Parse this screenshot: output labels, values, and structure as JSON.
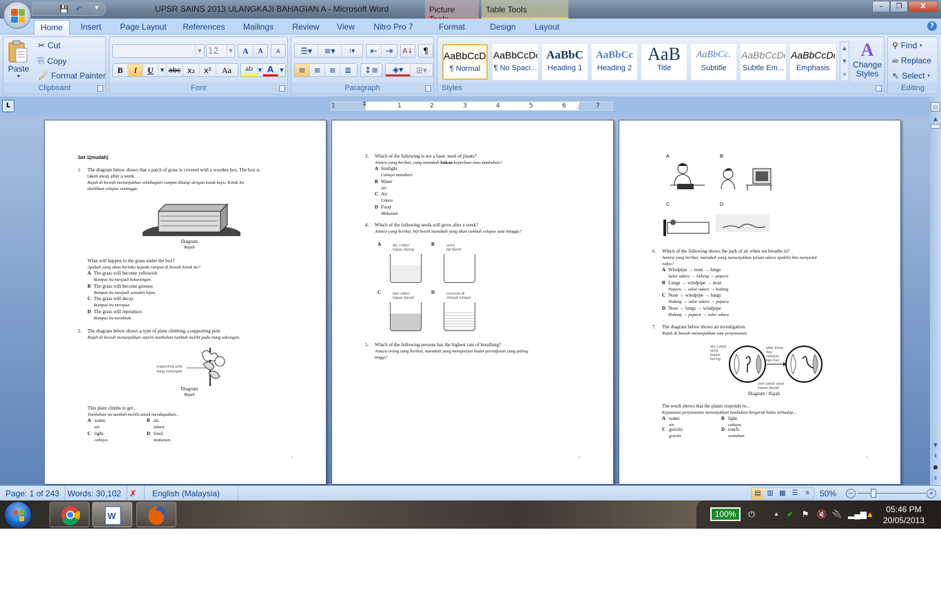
{
  "window": {
    "title": "UPSR SAINS 2013 ULANGKAJI BAHAGIAN A  -  Microsoft Word",
    "context_tabs": [
      "Picture Tools",
      "Table Tools"
    ],
    "controls": {
      "minimize": "–",
      "restore": "❐",
      "close": "X"
    }
  },
  "quick_access": {
    "save_icon": "💾",
    "undo_icon": "↶",
    "redo_icon": "↻",
    "more_icon": "▾"
  },
  "tabs": [
    {
      "label": "Home"
    },
    {
      "label": "Insert"
    },
    {
      "label": "Page Layout"
    },
    {
      "label": "References"
    },
    {
      "label": "Mailings"
    },
    {
      "label": "Review"
    },
    {
      "label": "View"
    },
    {
      "label": "Nitro Pro 7"
    },
    {
      "label": "Format"
    },
    {
      "label": "Design"
    },
    {
      "label": "Layout"
    }
  ],
  "ribbon": {
    "clipboard": {
      "label": "Clipboard",
      "paste": "Paste",
      "cut": "Cut",
      "copy": "Copy",
      "format_painter": "Format Painter"
    },
    "font": {
      "label": "Font",
      "font_name": "",
      "font_size": "12",
      "buttons": {
        "grow": "A",
        "shrink": "A",
        "clear": "A",
        "bold": "B",
        "italic": "I",
        "underline": "U",
        "strike": "abc",
        "subscript": "x₂",
        "superscript": "x²",
        "case": "Aa",
        "highlight": "ab",
        "color": "A"
      }
    },
    "paragraph": {
      "label": "Paragraph",
      "pilcrow": "¶",
      "sort": "A↓"
    },
    "styles": {
      "label": "Styles",
      "items": [
        {
          "sample": "AaBbCcDc",
          "name": "¶ Normal"
        },
        {
          "sample": "AaBbCcDc",
          "name": "¶ No Spaci..."
        },
        {
          "sample": "AaBbC",
          "name": "Heading 1"
        },
        {
          "sample": "AaBbCc",
          "name": "Heading 2"
        },
        {
          "sample": "AaB",
          "name": "Title"
        },
        {
          "sample": "AaBbCc.",
          "name": "Subtitle"
        },
        {
          "sample": "AaBbCcDc",
          "name": "Subtle Em..."
        },
        {
          "sample": "AaBbCcDc",
          "name": "Emphasis"
        }
      ],
      "change_styles": "Change Styles"
    },
    "editing": {
      "label": "Editing",
      "find": "Find",
      "replace": "Replace",
      "select": "Select"
    }
  },
  "ruler": {
    "numbers": [
      "1",
      "1",
      "2",
      "3",
      "4",
      "5",
      "6",
      "7"
    ],
    "corner": "L"
  },
  "pages": [
    {
      "number": "1",
      "heading": "Set 1(mudah)",
      "q1": {
        "num": "1.",
        "text1": "The diagram below shows that a patch of grass is covered with a wooden box. The box is",
        "text2": "taken away after a week.",
        "malay1": "Rajah di bawah menunjukkan sebahagian rumput ditutup dengan kotak kayu. Kotak itu",
        "malay2": "dialihkan selepas seminggu.",
        "caption": "Diagram",
        "caption_malay": "Rajah",
        "question": "What will happen to the grass under the box?",
        "question_malay": "Apakah yang akan berlaku kepada rumput di bawah kotak itu?",
        "options": [
          {
            "letter": "A",
            "text": "The grass will become yellowish.",
            "malay": "Rumput itu menjadi kekuningan."
          },
          {
            "letter": "B",
            "text": "The grass will become greener.",
            "malay": "Rumput itu menjadi semakin hijau."
          },
          {
            "letter": "C",
            "text": "The grass will decay.",
            "malay": "Rumput itu mereput."
          },
          {
            "letter": "D",
            "text": "The grass will reproduce.",
            "malay": "Rumput itu membiak."
          }
        ]
      },
      "q2": {
        "num": "2.",
        "text": "The diagram below shows a type of plant climbing a supporting pole.",
        "malay": "Rajah di bawah menunjukkan sejenis tumbuhan tumbuh melilit pada tiang sokongan.",
        "label1": "supporting pole",
        "label2": "tiang sokongan",
        "caption": "Diagram",
        "caption_malay": "Rajah",
        "question": "This plant climbs to get...",
        "question_malay": "Tumbuhan itu tumbuh melilit untuk mendapatkan...",
        "options": [
          {
            "letter": "A",
            "text": "water.",
            "malay": "air."
          },
          {
            "letter": "B",
            "text": "air.",
            "malay": "udara."
          },
          {
            "letter": "C",
            "text": "light.",
            "malay": "cahaya."
          },
          {
            "letter": "D",
            "text": "food.",
            "malay": "makanan."
          }
        ]
      }
    },
    {
      "number": "2",
      "q3": {
        "num": "3.",
        "text": "Which of the following is not a basic need of plants?",
        "malay_a": "Antara yang berikut, yang manakah",
        "malay_bold": "bukan",
        "malay_b": "keperluan asas tumbuhan?",
        "options": [
          {
            "letter": "A",
            "text": "Sunlight",
            "malay": "Cahaya matahari"
          },
          {
            "letter": "B",
            "text": "Water",
            "malay": "Air"
          },
          {
            "letter": "C",
            "text": "Air",
            "malay": "Udara"
          },
          {
            "letter": "D",
            "text": "Food",
            "malay": "Makanan"
          }
        ]
      },
      "q4": {
        "num": "4.",
        "text": "Which of the following seeds will grow after a week?",
        "malay": "Antara yang berikut, biji benih manakah yang akan tumbuh selepas satu minggu?",
        "beakers": [
          {
            "letter": "A",
            "label": "dry cotton",
            "label_malay": "kapas kering"
          },
          {
            "letter": "B",
            "label": "seed",
            "label_malay": "biji benih"
          },
          {
            "letter": "C",
            "label": "wet cotton",
            "label_malay": "kapas basah"
          },
          {
            "letter": "D",
            "label": "coconut oil",
            "label_malay": "minyak kelapa"
          }
        ]
      },
      "q5": {
        "num": "5.",
        "text": "Which of the following persons has the highest rate of breathing?",
        "malay1": "Antara orang yang berikut, manakah yang mempunyai kadar pernafasan yang paling",
        "malay2": "tinggi?"
      }
    },
    {
      "number": "3",
      "persons": [
        "A",
        "B",
        "C",
        "D"
      ],
      "q6": {
        "num": "6.",
        "text": "Which of the following shows the path of air when we breathe in?",
        "malay1": "Antara yang berikut, manakah yang menunjukkan laluan udara apabila kita menyedut",
        "malay2": "nafas?",
        "options": [
          {
            "letter": "A",
            "text": "Windpipe → nose → lungs",
            "malay": "Salur udara → hidung → peparu"
          },
          {
            "letter": "B",
            "text": "Lungs → windpipe → nose",
            "malay": "Peparu → salur udara → hidung"
          },
          {
            "letter": "C",
            "text": "Nose → windpipe → lungs",
            "malay": "Hidung → salur udara → peparu"
          },
          {
            "letter": "D",
            "text": "Nose → lungs → windpipe",
            "malay": "Hidung → peparu → salur udara"
          }
        ]
      },
      "q7": {
        "num": "7.",
        "text": "The diagram below shows an investigation.",
        "malay": "Rajah di bawah menunjukkan satu penyiasatan.",
        "labels": {
          "dry1": "dry cotton",
          "dry2": "wool",
          "dry3": "kapas",
          "dry4": "kering",
          "after1": "after three",
          "after2": "day",
          "after3": "selepas",
          "after4": "tiga hari",
          "wet1": "wet cotton wool",
          "wet2": "kapas basah"
        },
        "caption": "Diagram / Rajah",
        "question": "The result shows that the plants responds to...",
        "question_malay": "Keputusan penyiasatan menunjukkan tumbuhan bergerak balas terhadap...",
        "options": [
          {
            "letter": "A",
            "text": "water.",
            "malay": "air."
          },
          {
            "letter": "B",
            "text": "light.",
            "malay": "cahaya."
          },
          {
            "letter": "C",
            "text": "gravity.",
            "malay": "graviti."
          },
          {
            "letter": "D",
            "text": "touch.",
            "malay": "sentuhan."
          }
        ]
      }
    }
  ],
  "status": {
    "page": "Page: 1 of 243",
    "words": "Words: 30,102",
    "language": "English (Malaysia)",
    "zoom": "50%"
  },
  "taskbar": {
    "battery": "100%",
    "time": "05:46 PM",
    "date": "20/05/2013"
  }
}
